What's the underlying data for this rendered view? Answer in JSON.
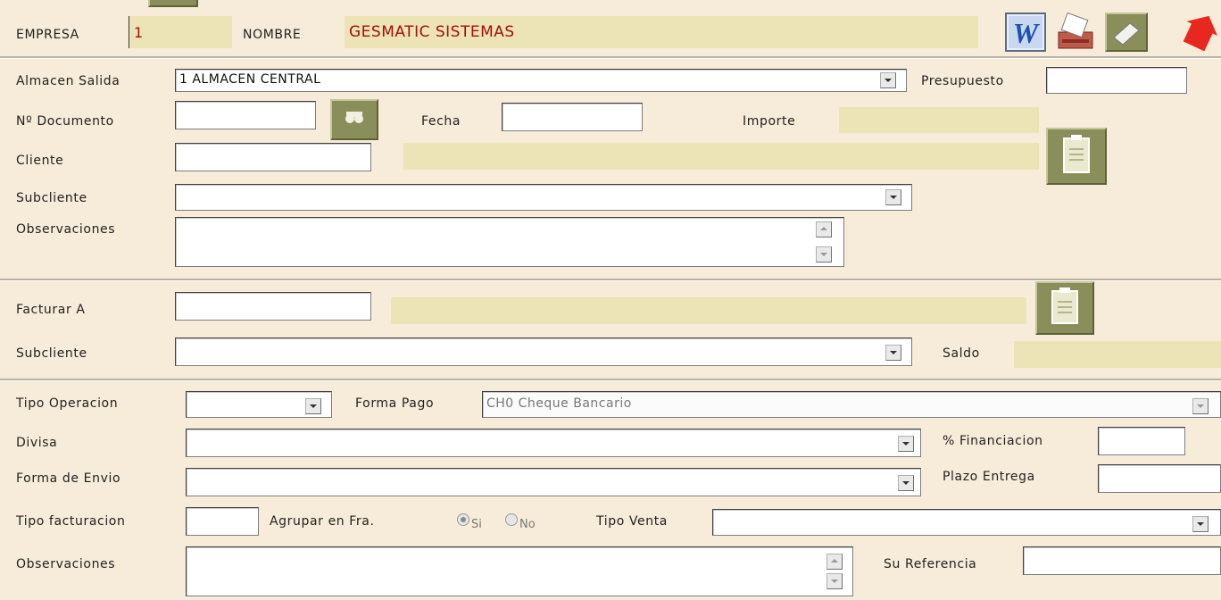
{
  "header": {
    "empresa_label": "EMPRESA",
    "empresa_value": "1",
    "nombre_label": "NOMBRE",
    "nombre_value": "GESMATIC SISTEMAS"
  },
  "toolbar": {
    "icons": [
      "word-icon",
      "print-icon",
      "eraser-icon",
      "exit-icon"
    ]
  },
  "document": {
    "almacen_label": "Almacen Salida",
    "almacen_value": "1 ALMACEN CENTRAL",
    "presupuesto_label": "Presupuesto",
    "presupuesto_value": "",
    "num_documento_label": "Nº Documento",
    "num_documento_value": "",
    "fecha_label": "Fecha",
    "fecha_value": "",
    "importe_label": "Importe",
    "importe_value": "",
    "cliente_label": "Cliente",
    "cliente_value": "",
    "subcliente_label": "Subcliente",
    "subcliente_value": "",
    "observaciones_label": "Observaciones",
    "observaciones_value": ""
  },
  "billing": {
    "facturar_label": "Facturar A",
    "facturar_value": "",
    "subcliente_label": "Subcliente",
    "subcliente_value": "",
    "saldo_label": "Saldo",
    "saldo_value": ""
  },
  "operation": {
    "tipo_operacion_label": "Tipo Operacion",
    "tipo_operacion_value": "",
    "forma_pago_label": "Forma Pago",
    "forma_pago_value": "CH0 Cheque Bancario",
    "divisa_label": "Divisa",
    "divisa_value": "",
    "financiacion_label": "% Financiacion",
    "financiacion_value": "",
    "forma_envio_label": "Forma de Envio",
    "forma_envio_value": "",
    "plazo_entrega_label": "Plazo Entrega",
    "plazo_entrega_value": "",
    "tipo_facturacion_label": "Tipo facturacion",
    "tipo_facturacion_value": "",
    "agrupar_label": "Agrupar en Fra.",
    "agrupar_si": "Si",
    "agrupar_no": "No",
    "agrupar_selected": "Si",
    "tipo_venta_label": "Tipo Venta",
    "tipo_venta_value": "",
    "observaciones_label": "Observaciones",
    "observaciones_value": "",
    "su_referencia_label": "Su Referencia",
    "su_referencia_value": ""
  },
  "colors": {
    "background": "#f7ecd9",
    "readonly_field": "#ece4b6",
    "company_name": "#a01010",
    "icon_button": "#8a8e5a"
  }
}
